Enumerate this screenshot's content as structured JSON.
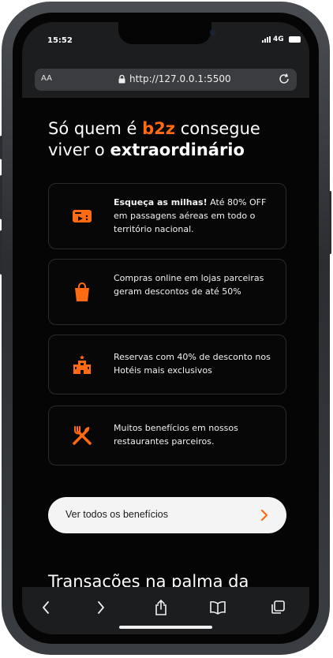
{
  "status_bar": {
    "time": "15:52",
    "network": "4G"
  },
  "browser": {
    "text_size_label": "AA",
    "url": "http://127.0.0.1:5500"
  },
  "headline": {
    "prefix": "Só quem é ",
    "brand": "b2z",
    "middle": " consegue viver o ",
    "emphasis": "extraordinário"
  },
  "benefits": [
    {
      "icon": "ticket-icon",
      "bold": "Esqueça as milhas!",
      "text": " Até 80% OFF em passagens aéreas em todo o território nacional."
    },
    {
      "icon": "shopping-bag-icon",
      "bold": "",
      "text": "Compras online em lojas parceiras geram descontos de até 50%"
    },
    {
      "icon": "hotel-icon",
      "bold": "",
      "text": "Reservas com 40% de desconto nos Hotéis mais exclusivos"
    },
    {
      "icon": "restaurant-icon",
      "bold": "",
      "text": "Muitos benefícios em nossos restaurantes parceiros."
    }
  ],
  "cta": {
    "label": "Ver todos os benefícios"
  },
  "section_title": "Transações na palma da",
  "colors": {
    "accent": "#ff6a13",
    "background": "#050505",
    "card_border": "#2a2a2a"
  }
}
